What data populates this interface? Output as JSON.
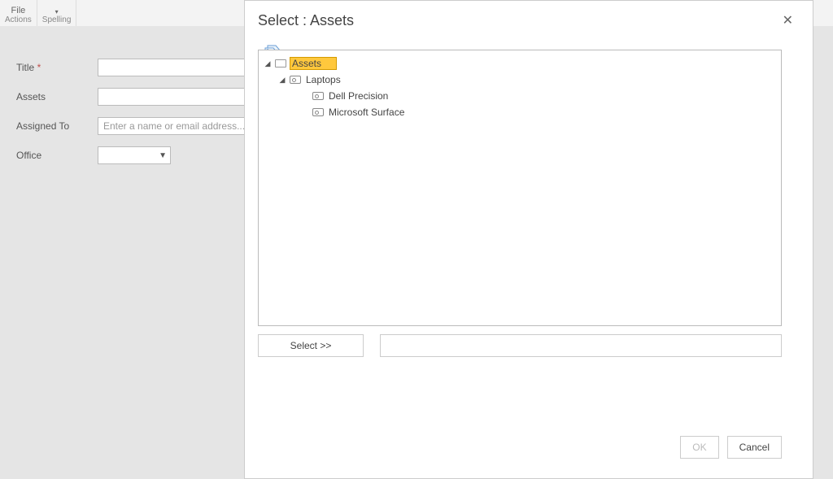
{
  "ribbon": {
    "file_label": "File",
    "actions_label": "Actions",
    "spelling_label": "Spelling"
  },
  "form": {
    "title_label": "Title",
    "assets_label": "Assets",
    "assigned_to_label": "Assigned To",
    "assigned_to_placeholder": "Enter a name or email address...",
    "office_label": "Office"
  },
  "dialog": {
    "title": "Select : Assets",
    "select_btn": "Select >>",
    "ok_label": "OK",
    "cancel_label": "Cancel",
    "tree": {
      "root": "Assets",
      "child1": "Laptops",
      "leaf1": "Dell Precision",
      "leaf2": "Microsoft Surface"
    }
  }
}
